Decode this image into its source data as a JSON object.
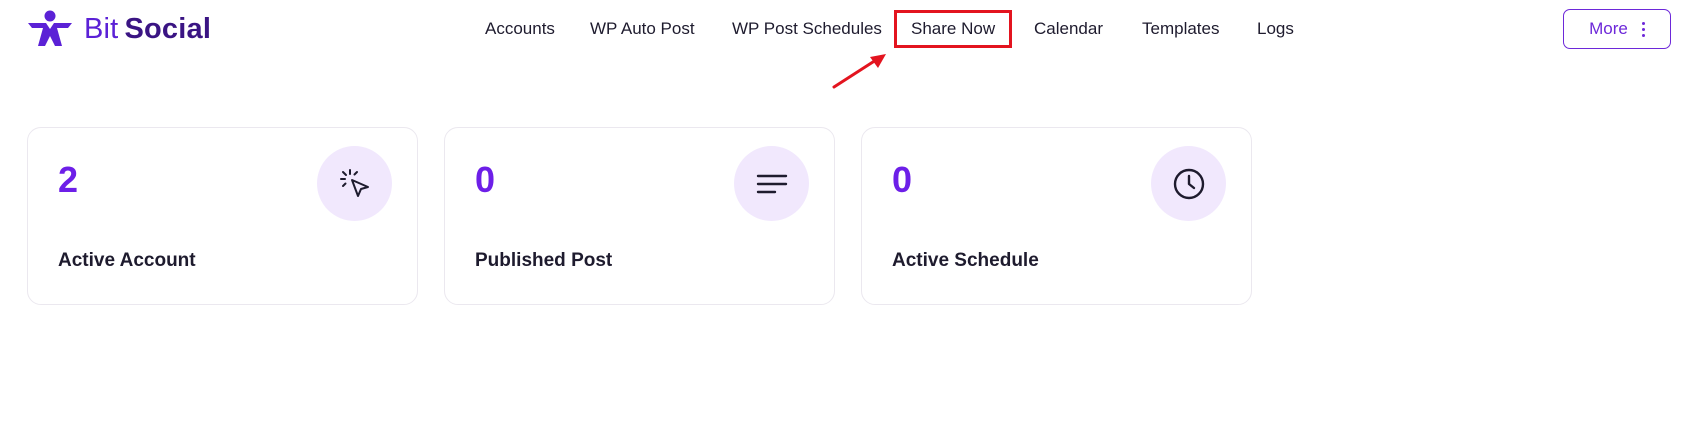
{
  "app": {
    "logo_bit": "Bit",
    "logo_social": "Social",
    "colors": {
      "brand": "#6d1fe8",
      "brand_dark": "#3a1483",
      "icon_bg": "#f1e8fd",
      "highlight": "#e3141f"
    }
  },
  "nav": {
    "items": [
      {
        "label": "Accounts"
      },
      {
        "label": "WP Auto Post"
      },
      {
        "label": "WP Post Schedules"
      },
      {
        "label": "Share Now",
        "highlighted": true
      },
      {
        "label": "Calendar"
      },
      {
        "label": "Templates"
      },
      {
        "label": "Logs"
      }
    ],
    "more_label": "More",
    "more_icon": "vertical-dots-icon"
  },
  "stats": {
    "cards": [
      {
        "value": "2",
        "label": "Active Account",
        "icon": "cursor-click-icon"
      },
      {
        "value": "0",
        "label": "Published Post",
        "icon": "text-lines-icon"
      },
      {
        "value": "0",
        "label": "Active Schedule",
        "icon": "clock-icon"
      }
    ]
  }
}
